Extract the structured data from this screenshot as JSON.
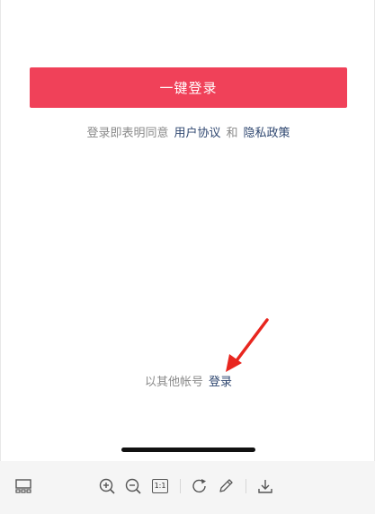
{
  "login": {
    "one_click_label": "一键登录",
    "agreement_prefix": "登录即表明同意",
    "user_agreement": "用户协议",
    "conjunction": "和",
    "privacy_policy": "隐私政策",
    "other_account_text": "以其他帐号",
    "other_account_link": "登录"
  },
  "toolbar": {
    "ratio_label": "1:1"
  },
  "colors": {
    "primary_button": "#f04159",
    "link": "#2f4770",
    "annotation_arrow": "#e8261f"
  }
}
